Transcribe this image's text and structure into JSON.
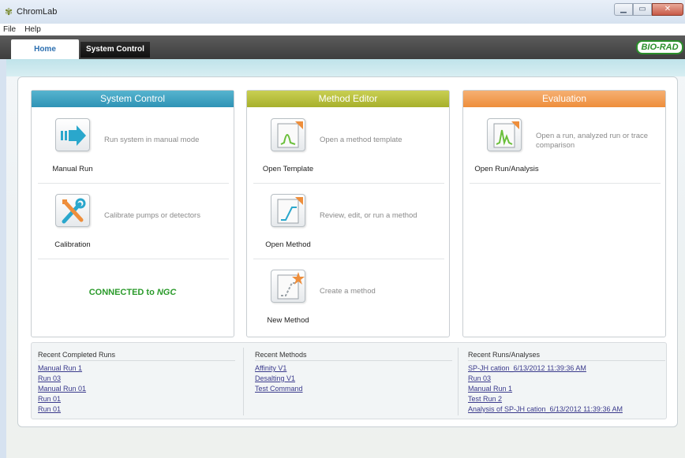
{
  "window": {
    "title": "ChromLab"
  },
  "menu": [
    "File",
    "Help"
  ],
  "tabs": {
    "home": "Home",
    "system_control": "System Control"
  },
  "brand": {
    "logo_text": "BIO-RAD"
  },
  "panels": {
    "system_control": {
      "title": "System Control",
      "items": [
        {
          "label": "Manual Run",
          "desc": "Run system in manual mode"
        },
        {
          "label": "Calibration",
          "desc": "Calibrate pumps or detectors"
        }
      ],
      "status_prefix": "CONNECTED to",
      "status_device": "NGC"
    },
    "method_editor": {
      "title": "Method Editor",
      "items": [
        {
          "label": "Open Template",
          "desc": "Open a method template"
        },
        {
          "label": "Open Method",
          "desc": "Review, edit, or run a method"
        },
        {
          "label": "New Method",
          "desc": "Create a method"
        }
      ]
    },
    "evaluation": {
      "title": "Evaluation",
      "items": [
        {
          "label": "Open Run/Analysis",
          "desc": "Open a run, analyzed run or trace comparison"
        }
      ]
    }
  },
  "recent": {
    "completed_runs": {
      "title": "Recent Completed Runs",
      "items": [
        "Manual Run 1",
        "Run 03",
        "Manual Run 01",
        "Run 01",
        "Run 01"
      ]
    },
    "methods": {
      "title": "Recent Methods",
      "items": [
        "Affinity V1",
        "Desalting V1",
        "Test Command"
      ]
    },
    "runs_analyses": {
      "title": "Recent Runs/Analyses",
      "items": [
        "SP-JH cation_6/13/2012 11:39:36 AM",
        "Run 03",
        "Manual Run 1",
        "Test Run 2",
        "Analysis of SP-JH cation_6/13/2012 11:39:36 AM"
      ]
    },
    "link_color": "#3a3a8c"
  },
  "colors": {
    "system_control": "#2f93b5",
    "method_editor": "#a7b02b",
    "evaluation": "#ee8e3b",
    "connected": "#2a9a2a"
  },
  "icons": {
    "manual_run": "arrow-right-icon",
    "calibration": "wrench-screwdriver-icon",
    "open_template": "template-peak-icon",
    "open_method": "method-step-icon",
    "new_method": "new-method-star-icon",
    "open_run": "chromatogram-icon"
  }
}
